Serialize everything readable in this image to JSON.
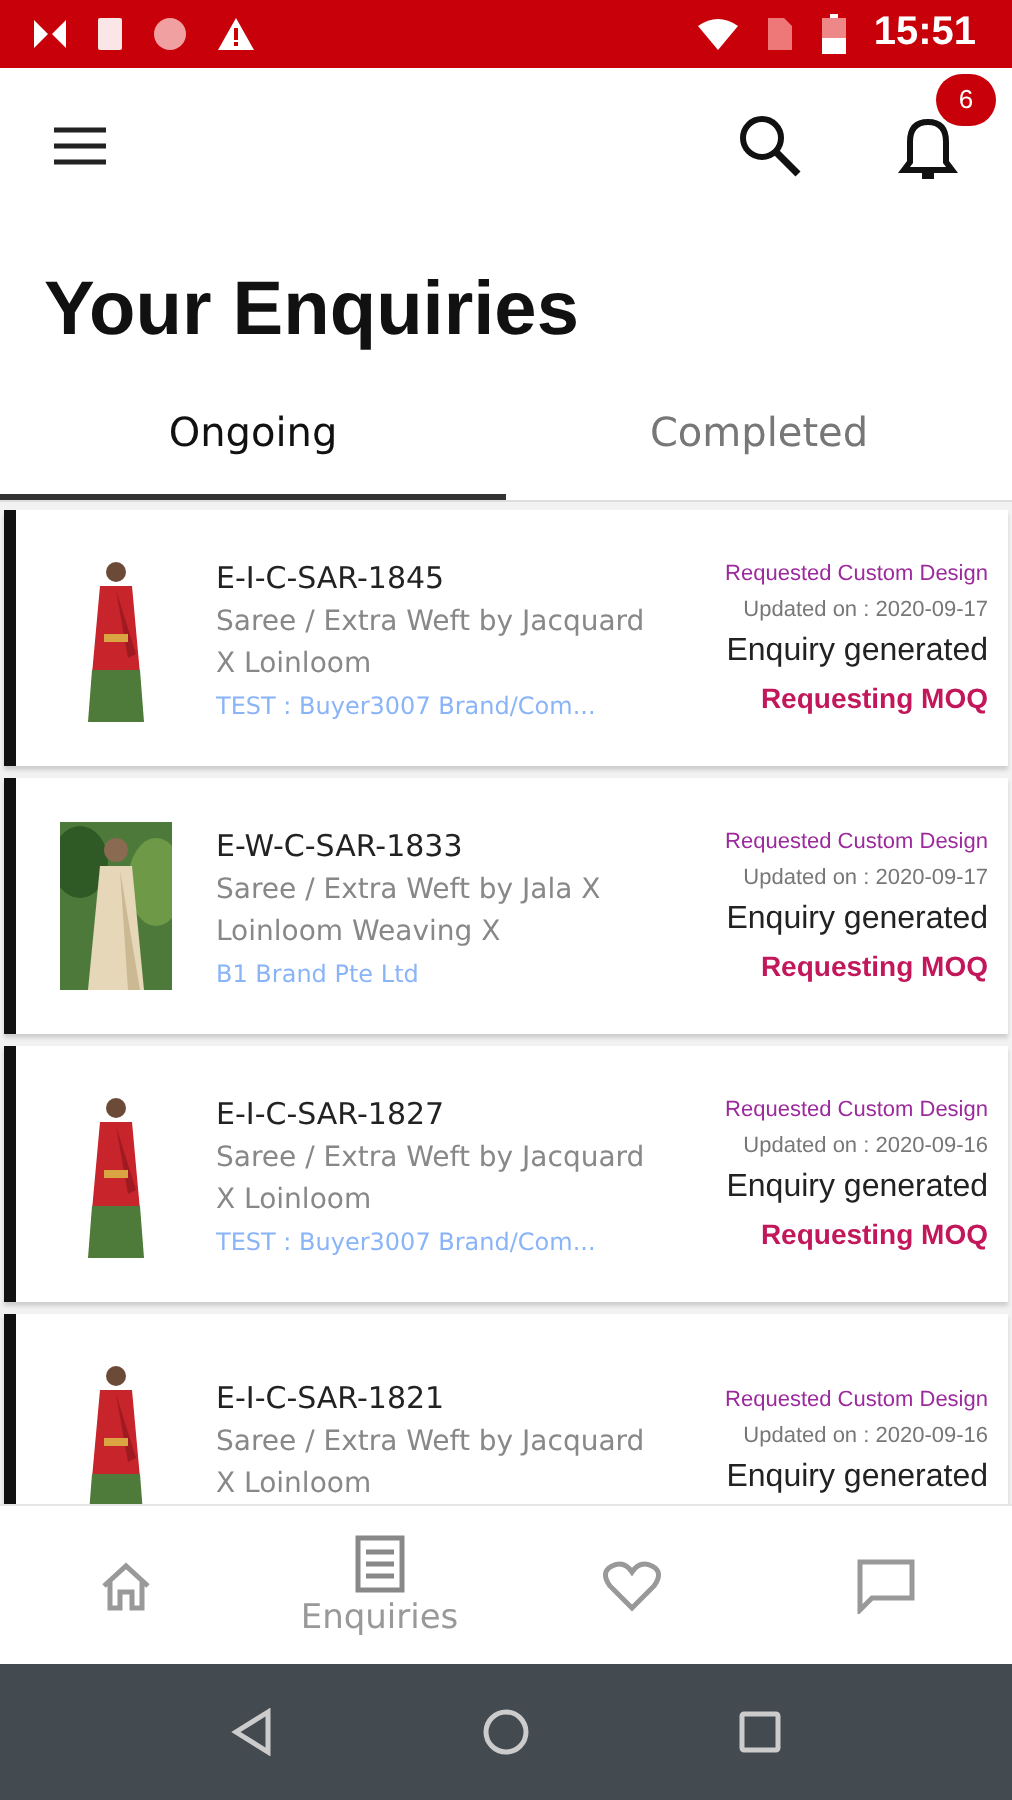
{
  "status_bar": {
    "time": "15:51"
  },
  "app_bar": {
    "notification_count": "6"
  },
  "title": "Your Enquiries",
  "tabs": [
    {
      "label": "Ongoing",
      "selected": true
    },
    {
      "label": "Completed",
      "selected": false
    }
  ],
  "enquiries": [
    {
      "code": "E-I-C-SAR-1845",
      "product": "Saree / Extra Weft by Jacquard X Loinloom",
      "brand": "TEST : Buyer3007 Brand/Com...",
      "type": "Requested Custom Design",
      "updated": "Updated on : 2020-09-17",
      "stage": "Enquiry generated",
      "action": "Requesting MOQ"
    },
    {
      "code": "E-W-C-SAR-1833",
      "product": "Saree / Extra Weft by Jala X Loinloom Weaving X",
      "brand": "B1 Brand Pte Ltd",
      "type": "Requested Custom Design",
      "updated": "Updated on : 2020-09-17",
      "stage": "Enquiry generated",
      "action": "Requesting MOQ"
    },
    {
      "code": "E-I-C-SAR-1827",
      "product": "Saree / Extra Weft by Jacquard X Loinloom",
      "brand": "TEST : Buyer3007 Brand/Com...",
      "type": "Requested Custom Design",
      "updated": "Updated on : 2020-09-16",
      "stage": "Enquiry generated",
      "action": "Requesting MOQ"
    },
    {
      "code": "E-I-C-SAR-1821",
      "product": "Saree / Extra Weft by Jacquard X Loinloom",
      "type": "Requested Custom Design",
      "updated": "Updated on : 2020-09-16",
      "stage": "Enquiry generated"
    }
  ],
  "bottom_nav": [
    {
      "kind": "home",
      "selected": false
    },
    {
      "kind": "enquiries",
      "label": "Enquiries",
      "selected": true
    },
    {
      "kind": "wishlist",
      "selected": false
    },
    {
      "kind": "chat",
      "selected": false
    }
  ]
}
